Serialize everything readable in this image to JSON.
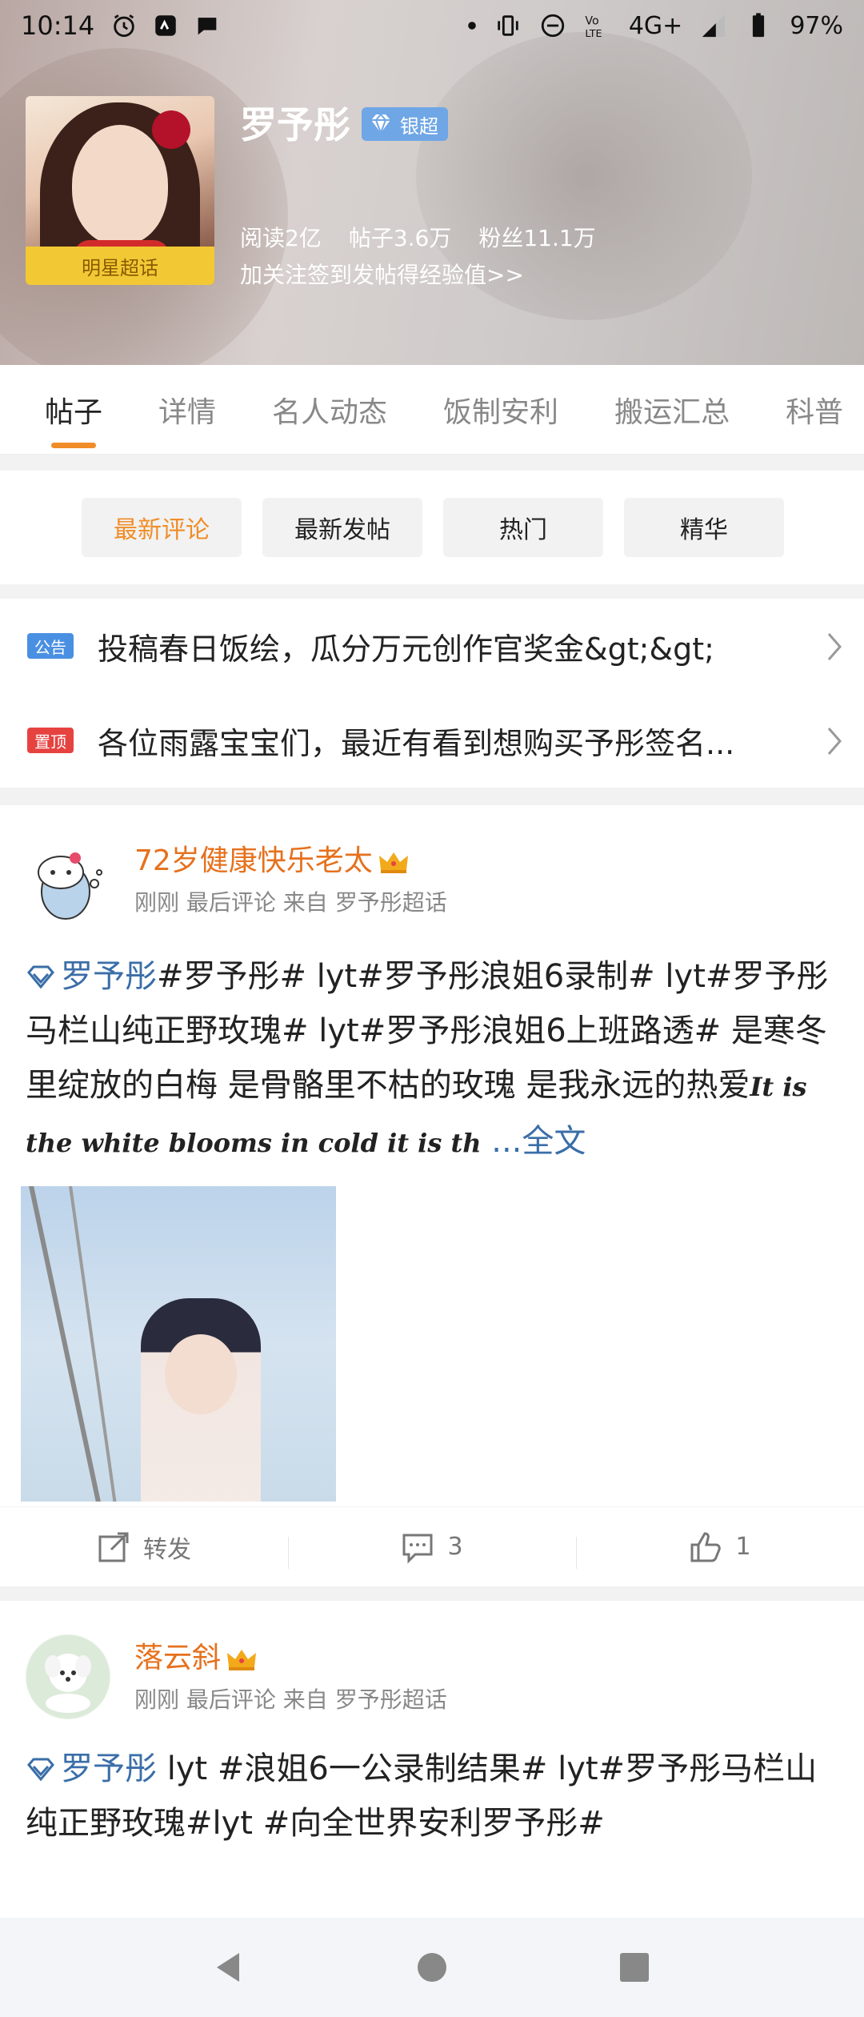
{
  "status_bar": {
    "time": "10:14",
    "network": "4G+",
    "battery": "97%",
    "icons_left": [
      "alarm-icon",
      "app-notification-icon",
      "chat-bubble-icon"
    ],
    "icons_right": [
      "dot-icon",
      "vibrate-icon",
      "do-not-disturb-icon",
      "volte-icon",
      "signal-icon",
      "battery-icon"
    ]
  },
  "profile": {
    "name": "罗予彤",
    "badge": "银超",
    "star_tag": "明星超话",
    "stats": [
      "阅读2亿",
      "帖子3.6万",
      "粉丝11.1万"
    ],
    "follow_hint": "加关注签到发帖得经验值>>"
  },
  "tabs": [
    {
      "label": "帖子",
      "active": true
    },
    {
      "label": "详情",
      "active": false
    },
    {
      "label": "名人动态",
      "active": false
    },
    {
      "label": "饭制安利",
      "active": false
    },
    {
      "label": "搬运汇总",
      "active": false
    },
    {
      "label": "科普",
      "active": false
    }
  ],
  "filters": [
    {
      "label": "最新评论",
      "active": true
    },
    {
      "label": "最新发帖",
      "active": false
    },
    {
      "label": "热门",
      "active": false
    },
    {
      "label": "精华",
      "active": false
    }
  ],
  "notices": [
    {
      "tag": "公告",
      "tag_color": "#4a90e2",
      "text": "投稿春日饭绘，瓜分万元创作官奖金&gt;&gt;"
    },
    {
      "tag": "置顶",
      "tag_color": "#e64340",
      "text": "各位雨露宝宝们，最近有看到想购买予彤签名..."
    }
  ],
  "posts": [
    {
      "username": "72岁健康快乐老太",
      "meta": "刚刚 最后评论 来自 罗予彤超话",
      "topic": "罗予彤",
      "text": "#罗予彤# lyt#罗予彤浪姐6录制# lyt#罗予彤马栏山纯正野玫瑰# lyt#罗予彤浪姐6上班路透# 是寒冬里绽放的白梅 是骨骼里不枯的玫瑰 是我永远的热爱",
      "script_text": "It is the white blooms in cold it is th",
      "more": " ...全文",
      "actions": {
        "repost": "转发",
        "comments": "3",
        "likes": "1"
      }
    },
    {
      "username": "落云斜",
      "meta": "刚刚 最后评论 来自 罗予彤超话",
      "topic": "罗予彤",
      "text": " lyt #浪姐6一公录制结果# lyt#罗予彤马栏山纯正野玫瑰#lyt #向全世界安利罗予彤#"
    }
  ],
  "colors": {
    "accent_orange": "#f08d28",
    "username_orange": "#e6711d",
    "link_blue": "#3a6ea8"
  }
}
